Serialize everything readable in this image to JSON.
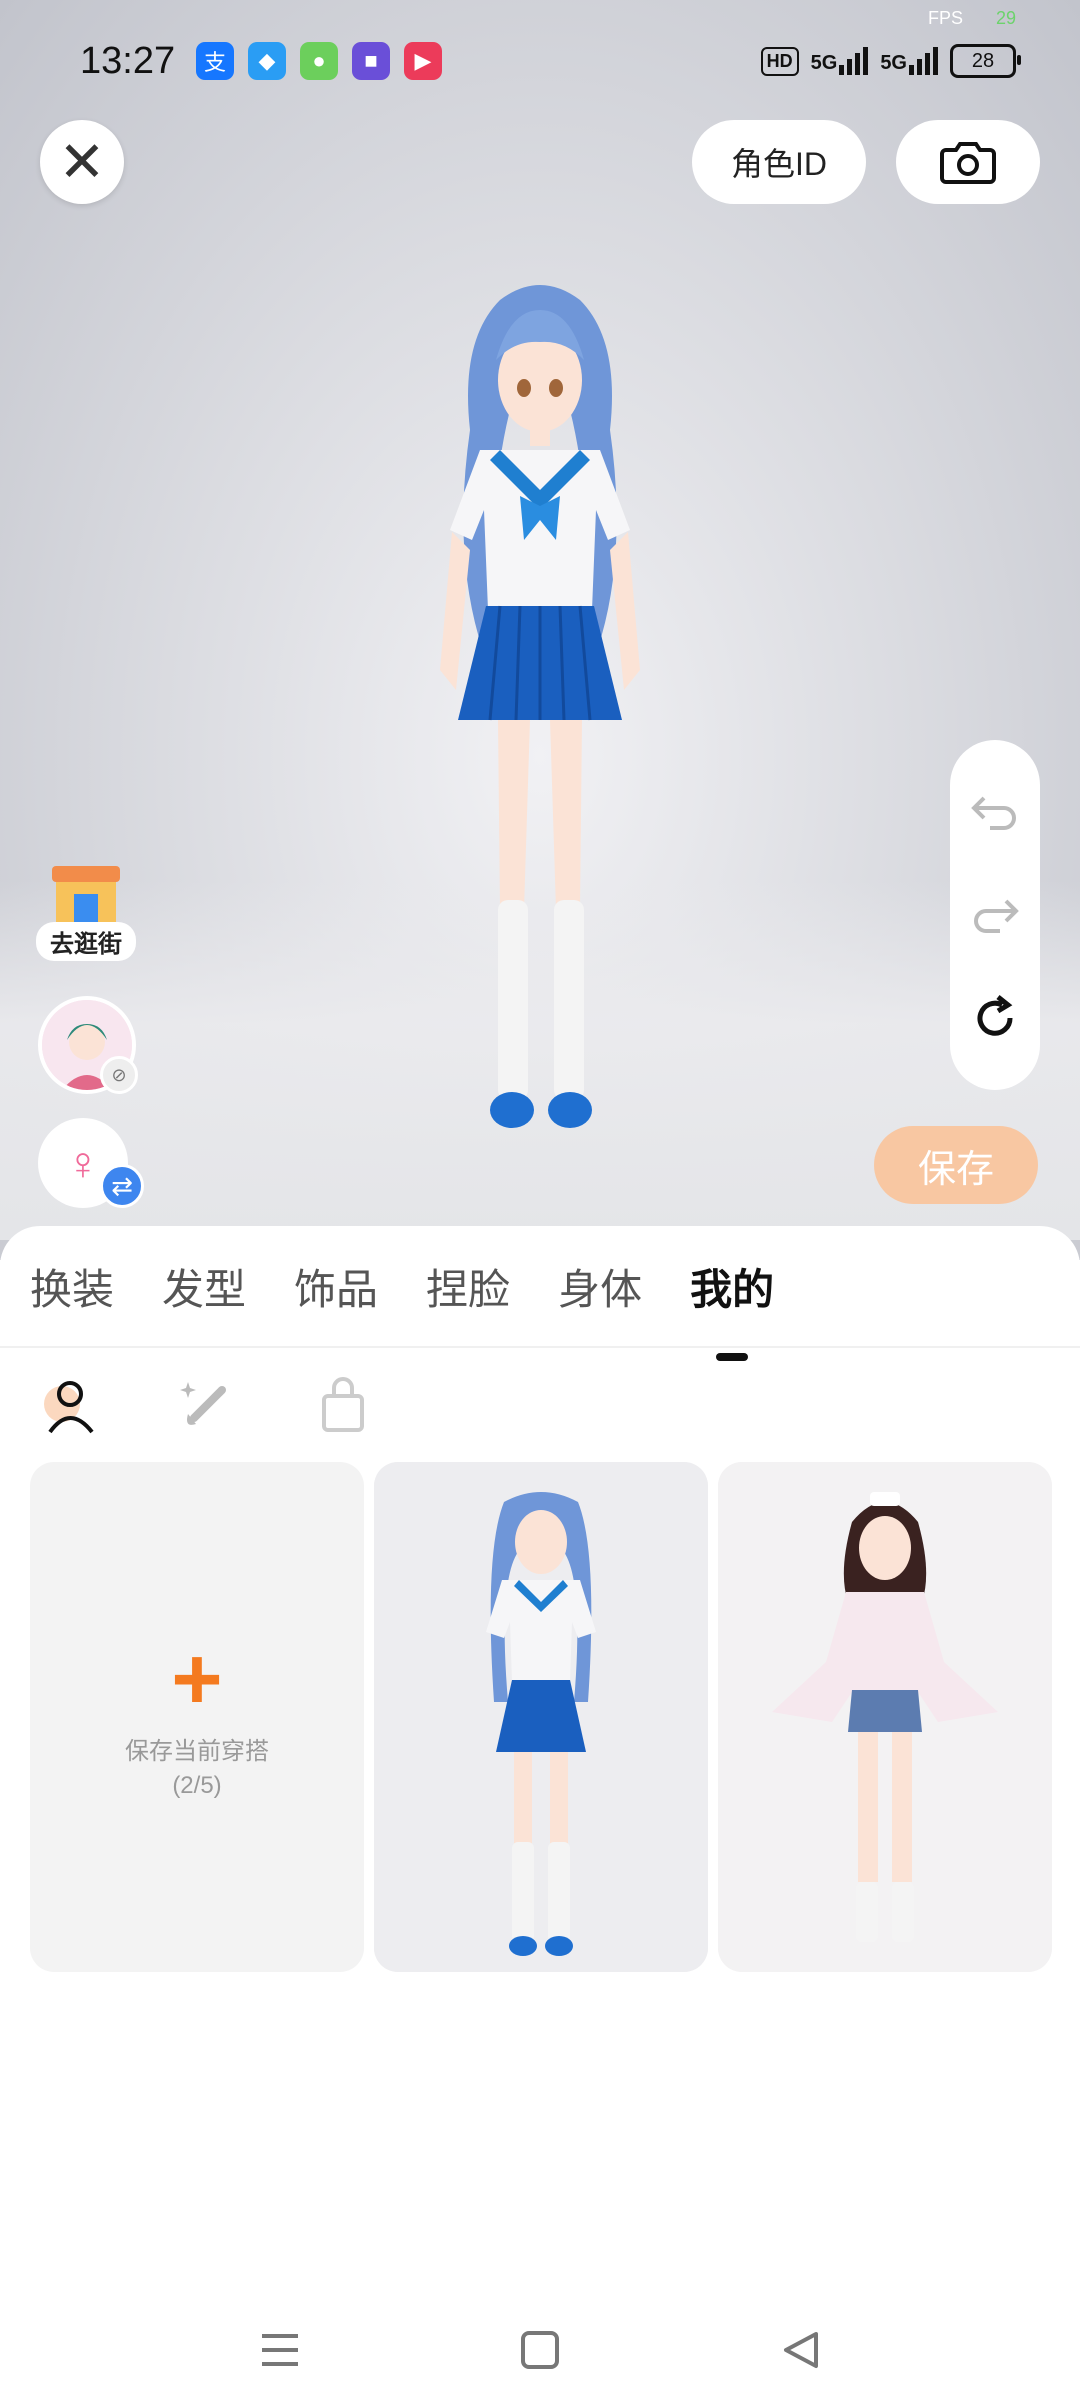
{
  "status_bar": {
    "time": "13:27",
    "fps_label": "FPS",
    "fps_value": "29",
    "hd_label": "HD",
    "signal1": "5G",
    "signal2": "5G",
    "battery": "28",
    "app_icons": [
      "alipay-icon",
      "browser-icon",
      "game-icon",
      "chat-icon",
      "video-icon"
    ]
  },
  "top": {
    "role_id_label": "角色ID"
  },
  "left_widgets": {
    "shop_label": "去逛街"
  },
  "controls": {
    "save_label": "保存"
  },
  "tabs": [
    {
      "label": "换装"
    },
    {
      "label": "发型"
    },
    {
      "label": "饰品"
    },
    {
      "label": "捏脸"
    },
    {
      "label": "身体"
    },
    {
      "label": "我的",
      "active": true
    }
  ],
  "outfits": {
    "add_label": "保存当前穿搭",
    "add_count": "(2/5)"
  },
  "colors": {
    "accent_orange": "#f47a1f",
    "save_peach": "#f8c7a2",
    "swap_blue": "#3e86ef"
  }
}
